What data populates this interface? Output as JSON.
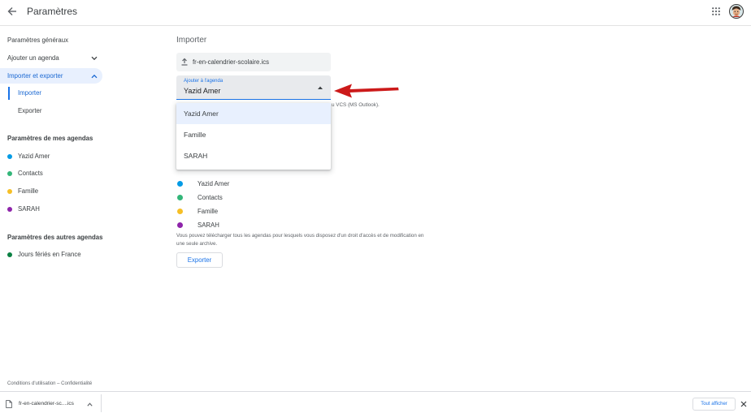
{
  "header": {
    "title": "Paramètres",
    "back_icon": "arrow-left-icon",
    "apps_icon": "apps-grid-icon",
    "avatar_icon": "user-avatar"
  },
  "sidebar": {
    "general": "Paramètres généraux",
    "add_calendar": "Ajouter un agenda",
    "import_export": "Importer et exporter",
    "import": "Importer",
    "export": "Exporter",
    "my_calendars_heading": "Paramètres de mes agendas",
    "my_calendars": [
      {
        "label": "Yazid Amer",
        "color": "#039be5"
      },
      {
        "label": "Contacts",
        "color": "#33b679"
      },
      {
        "label": "Famille",
        "color": "#f6bf26"
      },
      {
        "label": "SARAH",
        "color": "#8e24aa"
      }
    ],
    "other_calendars_heading": "Paramètres des autres agendas",
    "other_calendars": [
      {
        "label": "Jours fériés en France",
        "color": "#0b8043"
      }
    ],
    "legal": "Conditions d'utilisation – Confidentialité"
  },
  "import": {
    "heading": "Importer",
    "file_name": "fr-en-calendrier-scolaire.ics",
    "upload_icon": "upload-icon",
    "select_label": "Ajouter à l'agenda",
    "select_value": "Yazid Amer",
    "select_icon": "triangle-up-icon",
    "hint_visible": "u VCS (MS Outlook).",
    "options": [
      {
        "label": "Yazid Amer",
        "selected": true
      },
      {
        "label": "Famille",
        "selected": false
      },
      {
        "label": "SARAH",
        "selected": false
      }
    ]
  },
  "export": {
    "calendars": [
      {
        "label": "Yazid Amer",
        "color": "#039be5"
      },
      {
        "label": "Contacts",
        "color": "#33b679"
      },
      {
        "label": "Famille",
        "color": "#f6bf26"
      },
      {
        "label": "SARAH",
        "color": "#8e24aa"
      }
    ],
    "description_lines": [
      "Vous pouvez télécharger tous les agendas pour lesquels vous disposez d'un droit d'accès et de modification en",
      "une seule archive."
    ],
    "button": "Exporter"
  },
  "downloads": {
    "file_name": "fr-en-calendrier-sc....ics",
    "file_icon": "file-icon",
    "show_all": "Tout afficher",
    "close_icon": "close-icon"
  },
  "colors": {
    "accent": "#1a73e8",
    "highlight": "#e8f0fe",
    "annotation_arrow": "#cc1a1a"
  }
}
